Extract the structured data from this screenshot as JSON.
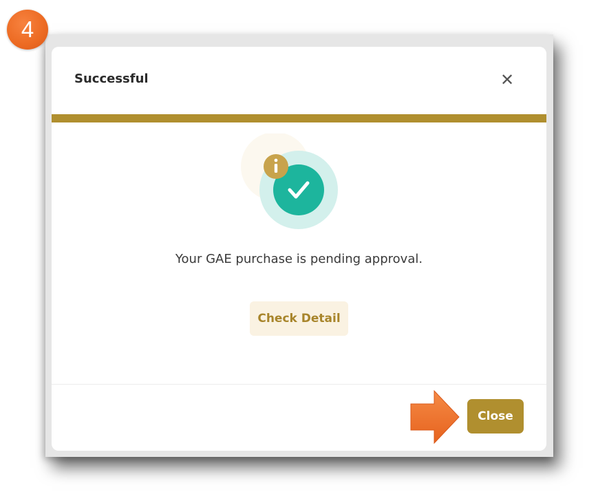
{
  "step": {
    "number": "4",
    "color": "#ec6a22"
  },
  "dialog": {
    "title": "Successful",
    "close_icon": "close-icon",
    "accent_color": "#b08f2f",
    "status_icons": [
      "check-circle-icon",
      "info-icon"
    ],
    "message": "Your GAE purchase is pending approval.",
    "check_detail_label": "Check Detail",
    "close_label": "Close"
  },
  "annotation": {
    "pointer_icon": "arrow-right-icon",
    "pointer_color": "#ef7228"
  }
}
